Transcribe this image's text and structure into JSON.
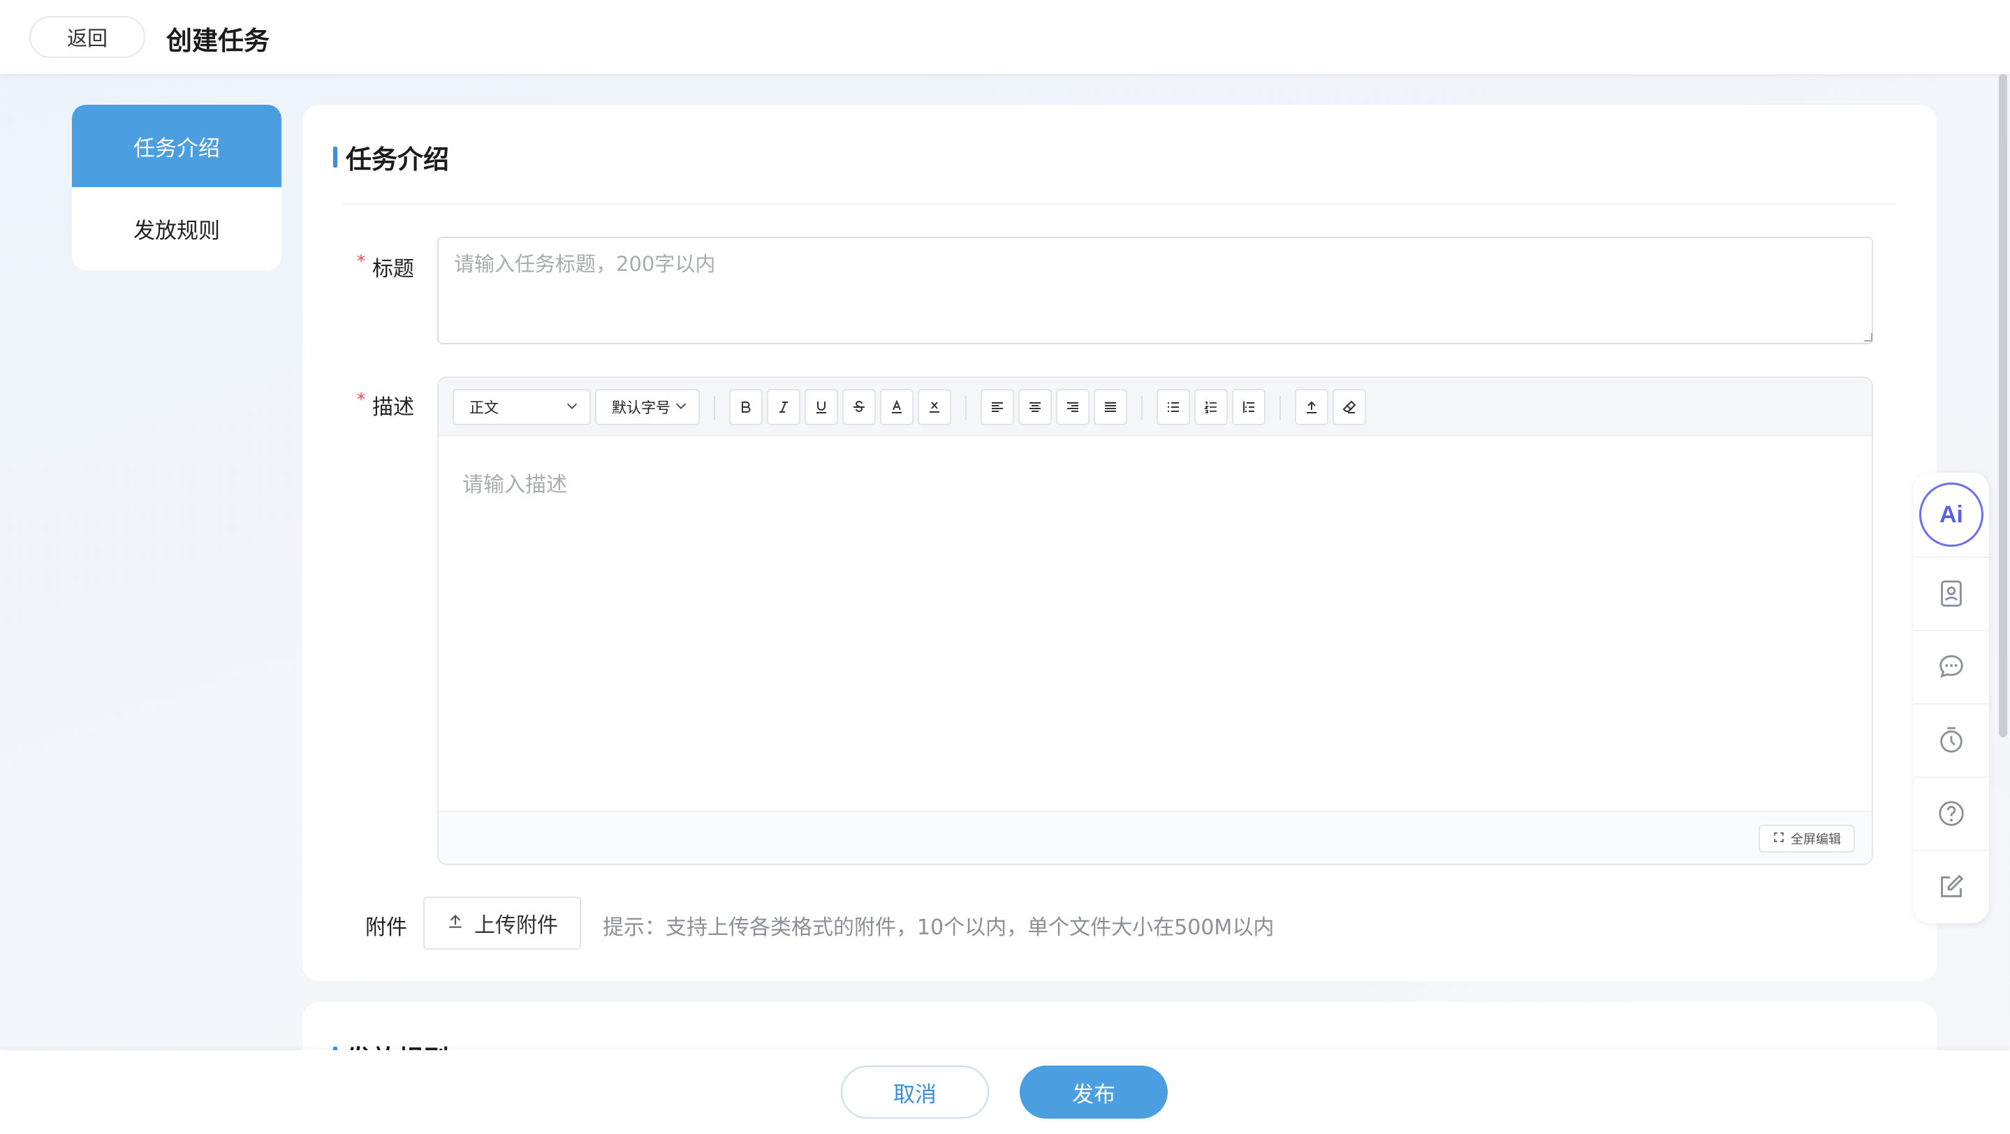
{
  "header": {
    "back_label": "返回",
    "title": "创建任务"
  },
  "sidebar": {
    "items": [
      {
        "label": "任务介绍",
        "active": true
      },
      {
        "label": "发放规则",
        "active": false
      }
    ]
  },
  "intro_section": {
    "title": "任务介绍",
    "title_field": {
      "label": "标题",
      "required_mark": "*",
      "placeholder": "请输入任务标题，200字以内",
      "value": ""
    },
    "desc_field": {
      "label": "描述",
      "required_mark": "*",
      "placeholder": "请输入描述",
      "paragraph_style": "正文",
      "font_size": "默认字号",
      "fullscreen_label": "全屏编辑"
    },
    "attachment": {
      "label": "附件",
      "upload_label": "上传附件",
      "hint": "提示：支持上传各类格式的附件，10个以内，单个文件大小在500M以内"
    }
  },
  "rules_section": {
    "title": "发放规则"
  },
  "footer": {
    "cancel_label": "取消",
    "publish_label": "发布"
  },
  "side_tools": {
    "ai_label": "Ai",
    "items": [
      "contact-card-icon",
      "chat-icon",
      "timer-icon",
      "help-icon",
      "edit-icon"
    ]
  },
  "colors": {
    "accent": "#4b9fe0",
    "required": "#f04747",
    "ai": "#5b5fe8"
  }
}
